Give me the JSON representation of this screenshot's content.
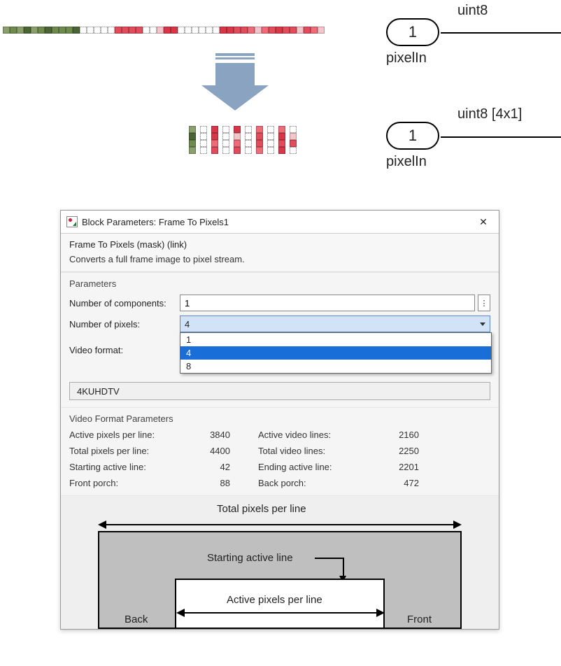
{
  "ports": {
    "port1": {
      "num": "1",
      "name": "pixelIn",
      "sig": "uint8"
    },
    "port2": {
      "num": "1",
      "name": "pixelIn",
      "sig": "uint8 [4x1]"
    }
  },
  "dialog": {
    "title": "Block Parameters: Frame To Pixels1",
    "mask_title": "Frame To Pixels (mask) (link)",
    "description": "Converts a full frame image to pixel stream.",
    "params_heading": "Parameters",
    "num_components_label": "Number of components:",
    "num_components_value": "1",
    "num_pixels_label": "Number of pixels:",
    "num_pixels_value": "4",
    "num_pixels_options": [
      "1",
      "4",
      "8"
    ],
    "num_pixels_selected": "4",
    "video_format_label": "Video format:",
    "video_format_value": "4KUHDTV",
    "vf_params_heading": "Video Format Parameters",
    "vf": {
      "active_px_label": "Active pixels per line:",
      "active_px": "3840",
      "active_lines_label": "Active video lines:",
      "active_lines": "2160",
      "total_px_label": "Total pixels per line:",
      "total_px": "4400",
      "total_lines_label": "Total video lines:",
      "total_lines": "2250",
      "start_line_label": "Starting active line:",
      "start_line": "42",
      "end_line_label": "Ending active line:",
      "end_line": "2201",
      "front_porch_label": "Front porch:",
      "front_porch": "88",
      "back_porch_label": "Back porch:",
      "back_porch": "472"
    },
    "diagram": {
      "total_px": "Total pixels per line",
      "start_line": "Starting active line",
      "active_px": "Active pixels per line",
      "back": "Back",
      "front": "Front"
    }
  },
  "illustration": {
    "top_strip_pattern": "ggggggggggghhhhhrrrrhhprrhhhhhhrrrrrprrrrrprrp",
    "rows_pattern": [
      "ggg",
      "hhh",
      "rrr",
      "hhh",
      "rpr",
      "hhh",
      "rrr",
      "hhh",
      "rrr",
      "hpr"
    ]
  }
}
